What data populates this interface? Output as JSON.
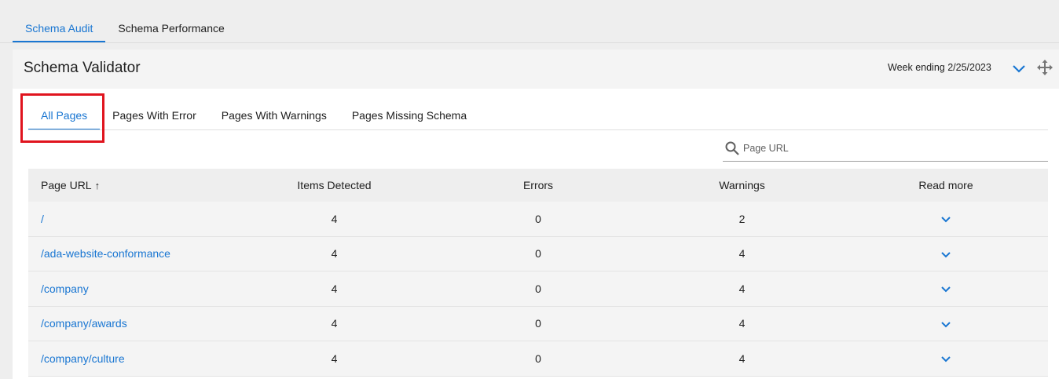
{
  "top_tabs": [
    {
      "label": "Schema Audit",
      "active": true
    },
    {
      "label": "Schema Performance",
      "active": false
    }
  ],
  "card": {
    "title": "Schema Validator",
    "week_label": "Week ending 2/25/2023"
  },
  "inner_tabs": [
    {
      "label": "All Pages",
      "active": true
    },
    {
      "label": "Pages With Error",
      "active": false
    },
    {
      "label": "Pages With Warnings",
      "active": false
    },
    {
      "label": "Pages Missing Schema",
      "active": false
    }
  ],
  "search": {
    "placeholder": "Page URL"
  },
  "table": {
    "headers": [
      "Page URL",
      "Items Detected",
      "Errors",
      "Warnings",
      "Read more"
    ],
    "sort_arrow": "↑",
    "rows": [
      {
        "url": "/",
        "items": "4",
        "errors": "0",
        "warnings": "2"
      },
      {
        "url": "/ada-website-conformance",
        "items": "4",
        "errors": "0",
        "warnings": "4"
      },
      {
        "url": "/company",
        "items": "4",
        "errors": "0",
        "warnings": "4"
      },
      {
        "url": "/company/awards",
        "items": "4",
        "errors": "0",
        "warnings": "4"
      },
      {
        "url": "/company/culture",
        "items": "4",
        "errors": "0",
        "warnings": "4"
      }
    ]
  },
  "colors": {
    "accent": "#1976d2",
    "highlight": "#e0141e"
  }
}
